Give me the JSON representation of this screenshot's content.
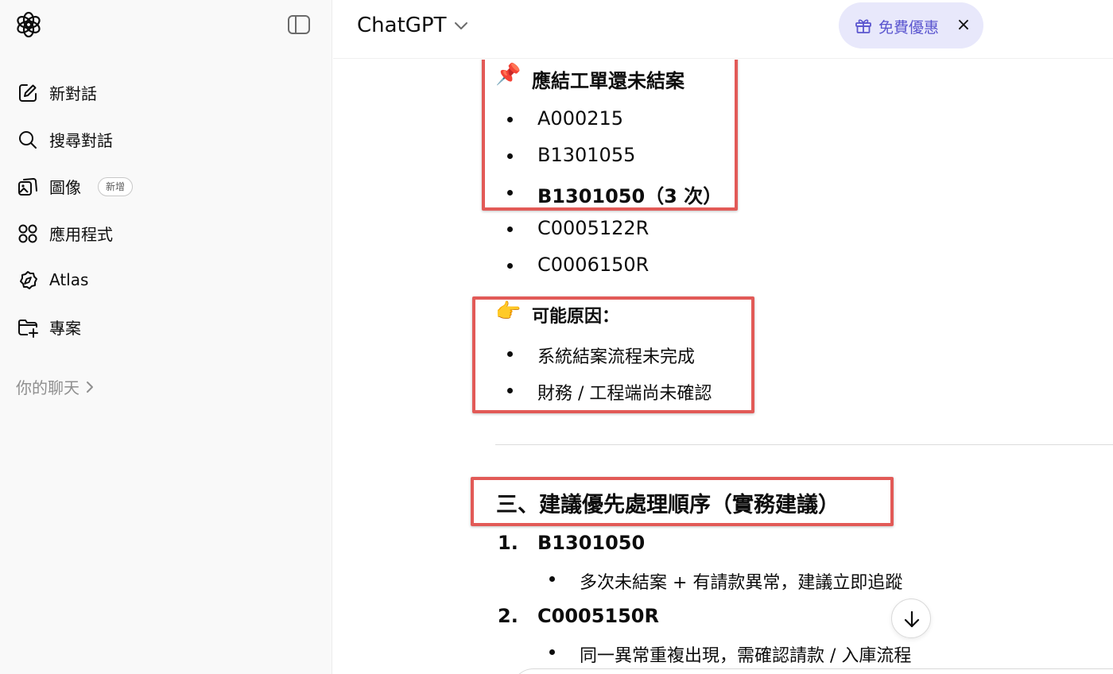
{
  "sidebar": {
    "items": [
      {
        "label": "新對話",
        "icon": "edit-icon"
      },
      {
        "label": "搜尋對話",
        "icon": "search-icon"
      },
      {
        "label": "圖像",
        "icon": "image-icon",
        "badge": "新增"
      },
      {
        "label": "應用程式",
        "icon": "apps-grid-icon"
      },
      {
        "label": "Atlas",
        "icon": "atlas-compass-icon"
      },
      {
        "label": "專案",
        "icon": "folder-plus-icon"
      }
    ],
    "section_label": "你的聊天"
  },
  "header": {
    "model_label": "ChatGPT",
    "promo_label": "免費優惠",
    "promo_close": "×"
  },
  "content": {
    "block1": {
      "emoji": "📌",
      "title": "應結工單還未結案",
      "items": [
        "A000215",
        "B1301055",
        "B1301050（3 次）",
        "C0005122R",
        "C0006150R"
      ]
    },
    "block2": {
      "emoji": "👉",
      "title": "可能原因：",
      "items": [
        "系統結案流程未完成",
        "財務 / 工程端尚未確認"
      ]
    },
    "section3": {
      "heading": "三、建議優先處理順序（實務建議）",
      "list": [
        {
          "num": "1.",
          "title": "B1301050",
          "sub": "多次未結案 + 有請款異常，建議立即追蹤"
        },
        {
          "num": "2.",
          "title": "C0005150R",
          "sub": "同一異常重複出現，需確認請款 / 入庫流程"
        }
      ]
    }
  },
  "colors": {
    "sidebar_bg": "#f9f9f9",
    "highlight_border": "#e25a57",
    "promo_bg": "#e8e8fb",
    "promo_text": "#5a55cf"
  }
}
